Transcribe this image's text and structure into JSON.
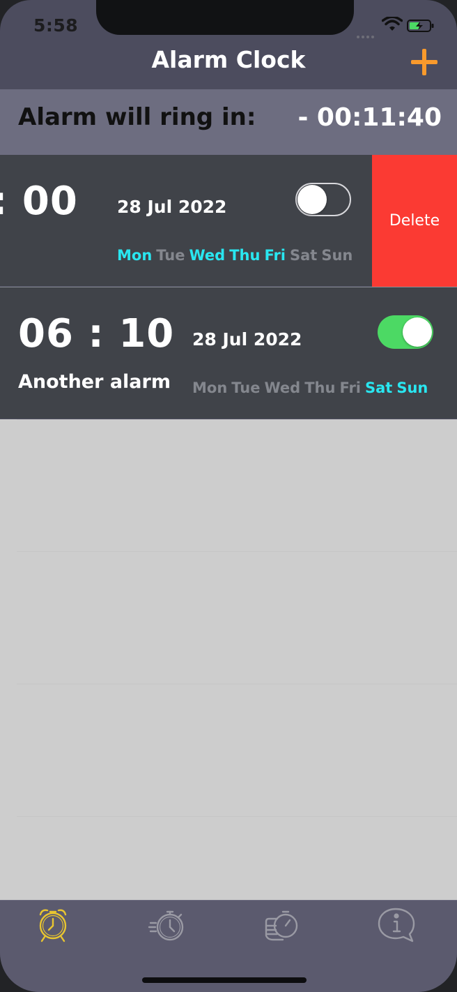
{
  "status_bar": {
    "time": "5:58"
  },
  "nav": {
    "title": "Alarm Clock",
    "add_icon": "plus-icon"
  },
  "countdown": {
    "label": "Alarm will ring in:",
    "value": "- 00:11:40"
  },
  "alarms": [
    {
      "time": ": 00",
      "date": "28 Jul 2022",
      "label": "",
      "enabled": false,
      "days": [
        {
          "name": "Mon",
          "active": true
        },
        {
          "name": "Tue",
          "active": false
        },
        {
          "name": "Wed",
          "active": true
        },
        {
          "name": "Thu",
          "active": true
        },
        {
          "name": "Fri",
          "active": true
        },
        {
          "name": "Sat",
          "active": false
        },
        {
          "name": "Sun",
          "active": false
        }
      ],
      "swipe_action": "Delete"
    },
    {
      "time": "06 : 10",
      "date": "28 Jul 2022",
      "label": "Another alarm",
      "enabled": true,
      "days": [
        {
          "name": "Mon",
          "active": false
        },
        {
          "name": "Tue",
          "active": false
        },
        {
          "name": "Wed",
          "active": false
        },
        {
          "name": "Thu",
          "active": false
        },
        {
          "name": "Fri",
          "active": false
        },
        {
          "name": "Sat",
          "active": true
        },
        {
          "name": "Sun",
          "active": true
        }
      ]
    }
  ],
  "tab_bar": {
    "tabs": [
      {
        "icon": "alarm-clock-icon",
        "selected": true
      },
      {
        "icon": "stopwatch-icon",
        "selected": false
      },
      {
        "icon": "timer-hand-icon",
        "selected": false
      },
      {
        "icon": "info-bubble-icon",
        "selected": false
      }
    ]
  },
  "colors": {
    "accent": "#f99a2c",
    "active_day": "#29e6f0",
    "inactive_day": "#84878e",
    "toggle_on": "#4cd964",
    "delete": "#fb3a33",
    "selected_tab": "#e8c530",
    "unselected_tab": "#9a9aa4"
  }
}
